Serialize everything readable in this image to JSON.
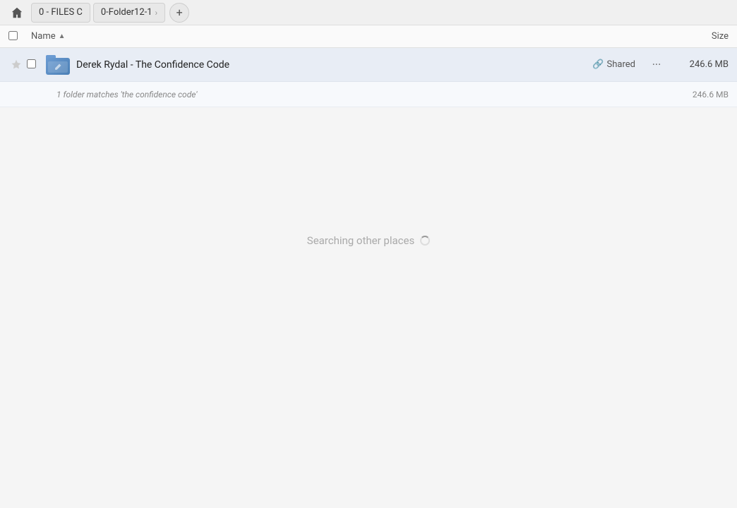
{
  "breadcrumb": {
    "home_icon": "🏠",
    "items": [
      {
        "label": "0 - FILES C",
        "id": "files-c"
      },
      {
        "label": "0-Folder12-1",
        "id": "folder12-1"
      }
    ],
    "add_label": "+"
  },
  "columns": {
    "name_label": "Name",
    "size_label": "Size"
  },
  "files": [
    {
      "id": "derek-rydal-confidence-code",
      "name": "Derek Rydal - The Confidence Code",
      "shared_label": "Shared",
      "size": "246.6 MB",
      "match_text": "1 folder matches 'the confidence code'",
      "match_size": "246.6 MB"
    }
  ],
  "searching": {
    "text": "Searching other places"
  }
}
